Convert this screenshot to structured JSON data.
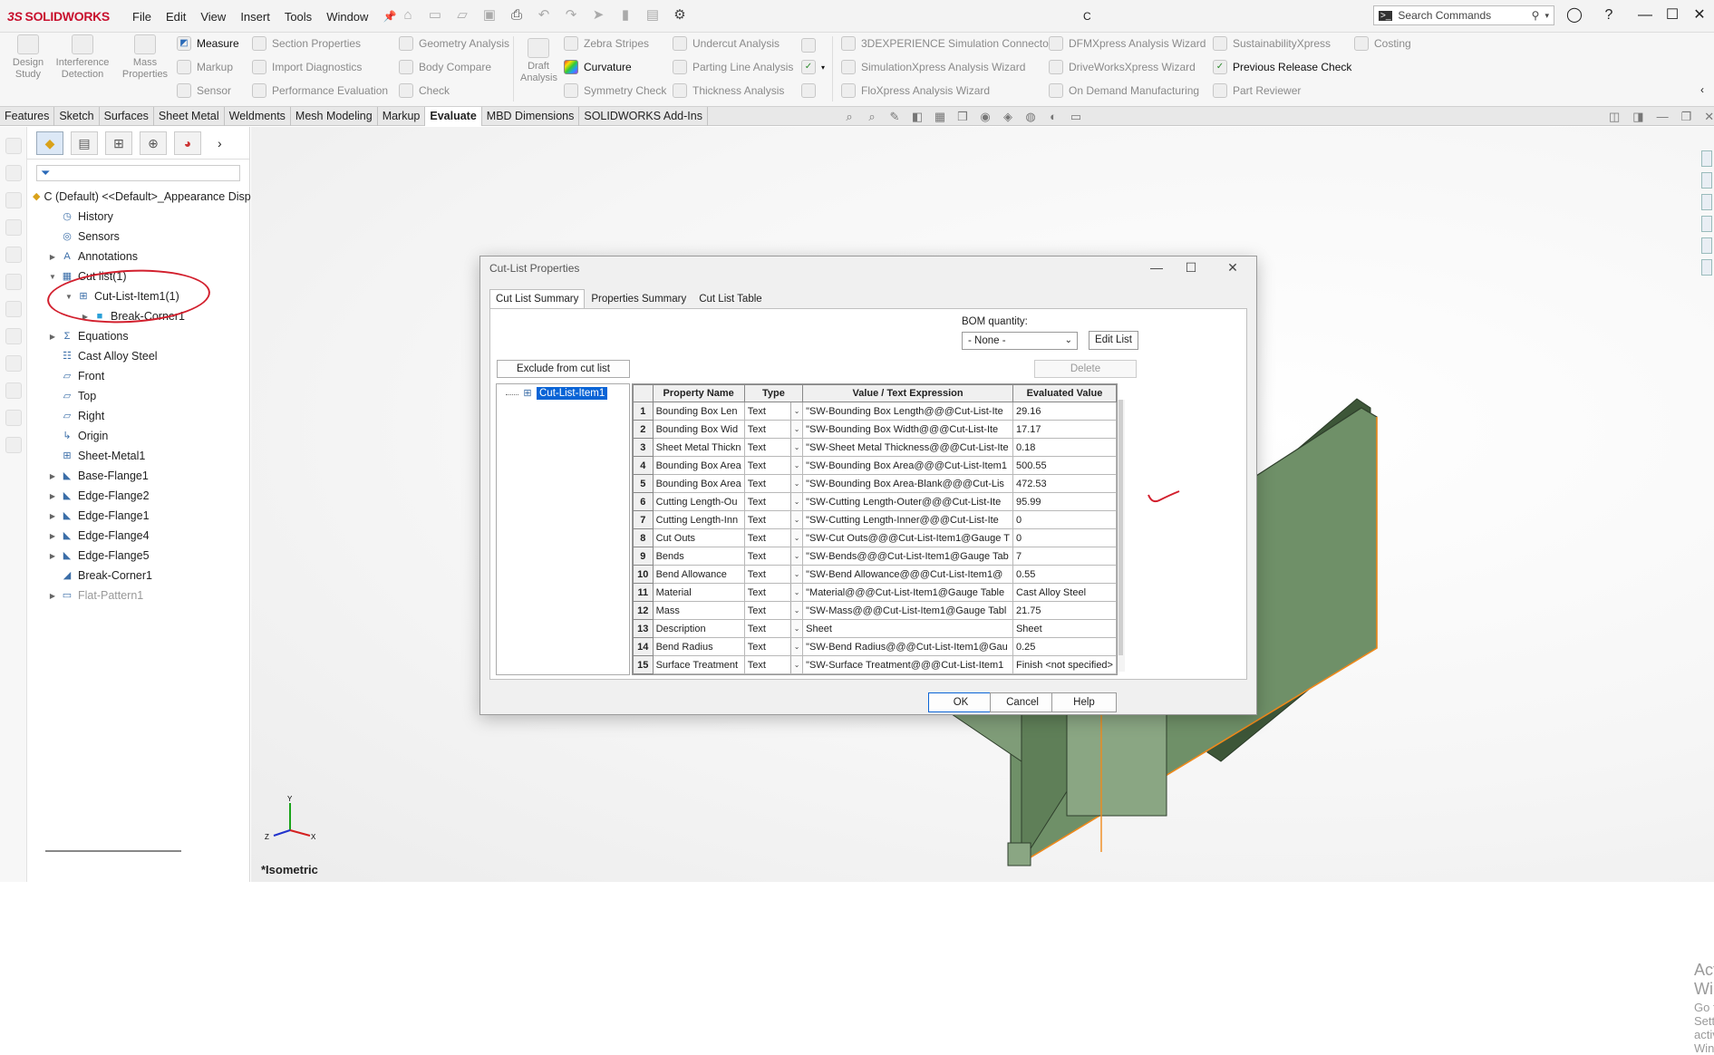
{
  "app": {
    "logo_text": "SOLIDWORKS",
    "logo_prefix": "3S",
    "menus": [
      "File",
      "Edit",
      "View",
      "Insert",
      "Tools",
      "Window"
    ],
    "document_title": "C",
    "search_placeholder": "Search Commands"
  },
  "ribbon": {
    "big_buttons": [
      {
        "label": "Design\nStudy"
      },
      {
        "label": "Interference\nDetection"
      },
      {
        "label": "Mass\nProperties"
      }
    ],
    "col1": [
      "Measure",
      "Markup",
      "Sensor"
    ],
    "col2": [
      "Section Properties",
      "Import Diagnostics",
      "Performance Evaluation"
    ],
    "col3": [
      "Geometry Analysis",
      "Body Compare",
      "Check"
    ],
    "draft": "Draft\nAnalysis",
    "col4": [
      "Zebra Stripes",
      "Curvature",
      "Symmetry Check"
    ],
    "col5": [
      "Undercut Analysis",
      "Parting Line Analysis",
      "Thickness Analysis"
    ],
    "col6": [
      "3DEXPERIENCE Simulation Connector",
      "SimulationXpress Analysis Wizard",
      "FloXpress Analysis Wizard"
    ],
    "col7": [
      "DFMXpress Analysis Wizard",
      "DriveWorksXpress Wizard",
      "On Demand Manufacturing"
    ],
    "col8": [
      "SustainabilityXpress",
      "Previous Release Check",
      "Part Reviewer"
    ],
    "col9": [
      "Costing"
    ]
  },
  "command_tabs": [
    "Features",
    "Sketch",
    "Surfaces",
    "Sheet Metal",
    "Weldments",
    "Mesh Modeling",
    "Markup",
    "Evaluate",
    "MBD Dimensions",
    "SOLIDWORKS Add-Ins"
  ],
  "active_tab": "Evaluate",
  "feature_tree": [
    {
      "label": "C (Default) <<Default>_Appearance Disp",
      "icon": "part-icon",
      "indent": 0,
      "expander": ""
    },
    {
      "label": "History",
      "icon": "history-icon",
      "indent": 1,
      "expander": ""
    },
    {
      "label": "Sensors",
      "icon": "sensors-icon",
      "indent": 1,
      "expander": ""
    },
    {
      "label": "Annotations",
      "icon": "annotations-icon",
      "indent": 1,
      "expander": "▶"
    },
    {
      "label": "Cut list(1)",
      "icon": "cut-list-icon",
      "indent": 1,
      "expander": "▼"
    },
    {
      "label": "Cut-List-Item1(1)",
      "icon": "cut-list-item-icon",
      "indent": 2,
      "expander": "▼"
    },
    {
      "label": "Break-Corner1",
      "icon": "body-icon",
      "indent": 3,
      "expander": "▶"
    },
    {
      "label": "Equations",
      "icon": "equations-icon",
      "indent": 1,
      "expander": "▶"
    },
    {
      "label": "Cast Alloy Steel",
      "icon": "material-icon",
      "indent": 1,
      "expander": ""
    },
    {
      "label": "Front",
      "icon": "plane-icon",
      "indent": 1,
      "expander": ""
    },
    {
      "label": "Top",
      "icon": "plane-icon",
      "indent": 1,
      "expander": ""
    },
    {
      "label": "Right",
      "icon": "plane-icon",
      "indent": 1,
      "expander": ""
    },
    {
      "label": "Origin",
      "icon": "origin-icon",
      "indent": 1,
      "expander": ""
    },
    {
      "label": "Sheet-Metal1",
      "icon": "sheet-metal-icon",
      "indent": 1,
      "expander": ""
    },
    {
      "label": "Base-Flange1",
      "icon": "flange-icon",
      "indent": 1,
      "expander": "▶"
    },
    {
      "label": "Edge-Flange2",
      "icon": "flange-icon",
      "indent": 1,
      "expander": "▶"
    },
    {
      "label": "Edge-Flange1",
      "icon": "flange-icon",
      "indent": 1,
      "expander": "▶"
    },
    {
      "label": "Edge-Flange4",
      "icon": "flange-icon",
      "indent": 1,
      "expander": "▶"
    },
    {
      "label": "Edge-Flange5",
      "icon": "flange-icon",
      "indent": 1,
      "expander": "▶"
    },
    {
      "label": "Break-Corner1",
      "icon": "break-corner-icon",
      "indent": 1,
      "expander": ""
    },
    {
      "label": "Flat-Pattern1",
      "icon": "flat-pattern-icon",
      "indent": 1,
      "expander": "▶",
      "dim": true
    }
  ],
  "viewport": {
    "view_label": "*Isometric",
    "activate_title": "Activate Windows",
    "activate_sub": "Go to Settings to activate Windows."
  },
  "dialog": {
    "title": "Cut-List Properties",
    "tabs": [
      "Cut List Summary",
      "Properties Summary",
      "Cut List Table"
    ],
    "active_tab": "Cut List Summary",
    "bom_label": "BOM quantity:",
    "bom_value": "- None -",
    "edit_list": "Edit List",
    "exclude": "Exclude from cut list",
    "delete": "Delete",
    "tree_item": "Cut-List-Item1",
    "columns": [
      "Property Name",
      "Type",
      "Value / Text Expression",
      "Evaluated Value"
    ],
    "rows": [
      {
        "n": "1",
        "name": "Bounding Box Len",
        "type": "Text",
        "expr": "\"SW-Bounding Box Length@@@Cut-List-Ite",
        "val": "29.16"
      },
      {
        "n": "2",
        "name": "Bounding Box Wid",
        "type": "Text",
        "expr": "\"SW-Bounding Box Width@@@Cut-List-Ite",
        "val": "17.17"
      },
      {
        "n": "3",
        "name": "Sheet Metal Thickn",
        "type": "Text",
        "expr": "\"SW-Sheet Metal Thickness@@@Cut-List-Ite",
        "val": "0.18"
      },
      {
        "n": "4",
        "name": "Bounding Box Area",
        "type": "Text",
        "expr": "\"SW-Bounding Box Area@@@Cut-List-Item1",
        "val": "500.55"
      },
      {
        "n": "5",
        "name": "Bounding Box Area",
        "type": "Text",
        "expr": "\"SW-Bounding Box Area-Blank@@@Cut-Lis",
        "val": "472.53"
      },
      {
        "n": "6",
        "name": "Cutting Length-Ou",
        "type": "Text",
        "expr": "\"SW-Cutting Length-Outer@@@Cut-List-Ite",
        "val": "95.99"
      },
      {
        "n": "7",
        "name": "Cutting Length-Inn",
        "type": "Text",
        "expr": "\"SW-Cutting Length-Inner@@@Cut-List-Ite",
        "val": "0"
      },
      {
        "n": "8",
        "name": "Cut Outs",
        "type": "Text",
        "expr": "\"SW-Cut Outs@@@Cut-List-Item1@Gauge T",
        "val": "0"
      },
      {
        "n": "9",
        "name": "Bends",
        "type": "Text",
        "expr": "\"SW-Bends@@@Cut-List-Item1@Gauge Tab",
        "val": "7"
      },
      {
        "n": "10",
        "name": "Bend Allowance",
        "type": "Text",
        "expr": "\"SW-Bend Allowance@@@Cut-List-Item1@",
        "val": "0.55"
      },
      {
        "n": "11",
        "name": "Material",
        "type": "Text",
        "expr": "\"Material@@@Cut-List-Item1@Gauge Table",
        "val": "Cast Alloy Steel"
      },
      {
        "n": "12",
        "name": "Mass",
        "type": "Text",
        "expr": "\"SW-Mass@@@Cut-List-Item1@Gauge Tabl",
        "val": "21.75"
      },
      {
        "n": "13",
        "name": "Description",
        "type": "Text",
        "expr": "Sheet",
        "val": "Sheet"
      },
      {
        "n": "14",
        "name": "Bend Radius",
        "type": "Text",
        "expr": "\"SW-Bend Radius@@@Cut-List-Item1@Gau",
        "val": "0.25"
      },
      {
        "n": "15",
        "name": "Surface Treatment",
        "type": "Text",
        "expr": "\"SW-Surface Treatment@@@Cut-List-Item1",
        "val": "Finish <not specified>"
      }
    ],
    "ok": "OK",
    "cancel": "Cancel",
    "help": "Help"
  },
  "colors": {
    "brand": "#c8102e",
    "model_face": "#6f9068",
    "selection": "#0a64d6",
    "annotation": "#d21f2d",
    "edge_highlight": "#f08a1c"
  }
}
